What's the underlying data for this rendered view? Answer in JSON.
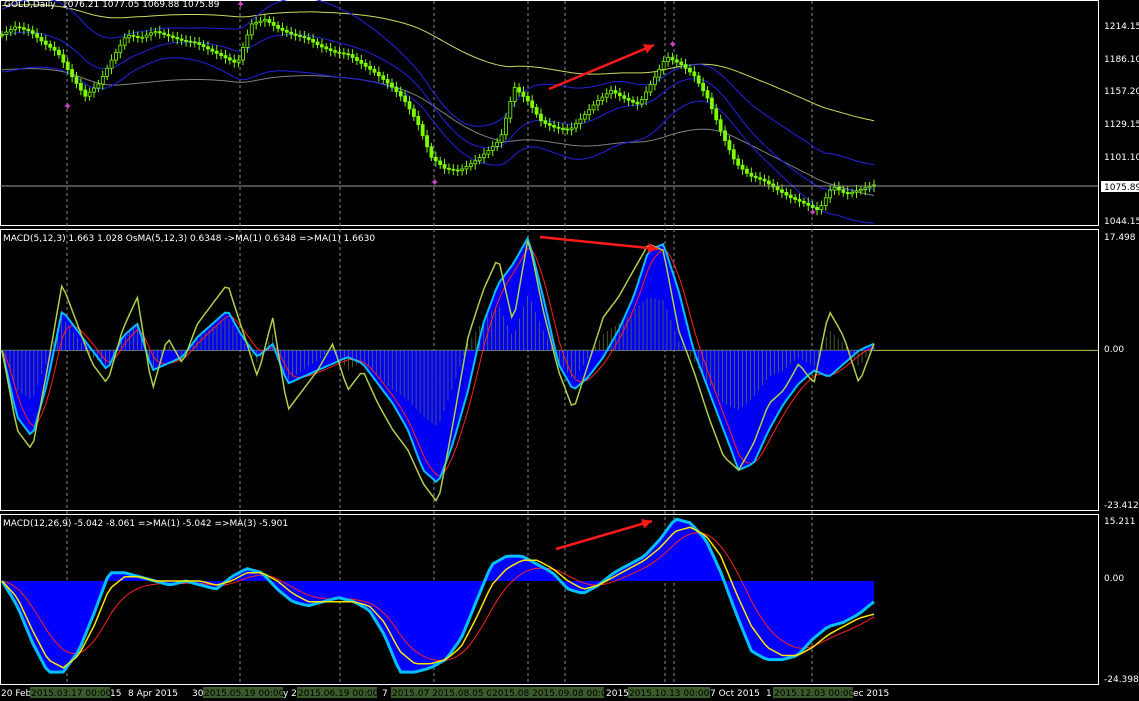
{
  "colors": {
    "background": "#000000",
    "price_candle": "#7CFC00",
    "bollinger": "#1E22E6",
    "ma_yellow": "#C8DC60",
    "ma_gray": "#808080",
    "macd_hist": "#0000FF",
    "macd_main": "#00BFFF",
    "signal_red": "#FF2020",
    "osma_line": "#ADD04A",
    "yellow_line": "#FFE600",
    "arrow": "#FF1A1A",
    "pane_border": "#FFFFFF",
    "date_box": "#3A5A2A"
  },
  "header": {
    "symbol": "GOLD,Daily",
    "ohlc": "1076.21 1077.05 1069.88 1075.89"
  },
  "pane1": {
    "price_axis": [
      "1214.15",
      "1186.10",
      "1157.20",
      "1129.15",
      "1101.10",
      "1075.89",
      "1044.15"
    ],
    "current_price": "1075.89"
  },
  "pane2": {
    "label": "MACD(5,12,3) 1.663 1.028  OsMA(5,12,3) 0.6348  ->MA(1) 0.6348  =>MA(1) 1.6630",
    "axis_top": "17.498",
    "axis_zero": "0.00",
    "axis_bottom": "-23.412"
  },
  "pane3": {
    "label": "MACD(12,26,9) -5.042 -8.061  =>MA(1) -5.042  =>MA(3) -5.901",
    "axis_top": "15.211",
    "axis_zero": "0.00",
    "axis_bottom": "-24.398"
  },
  "time_axis": {
    "labels": [
      "20 Feb",
      "15",
      "8 Apr 2015",
      "30",
      "y 20",
      "7",
      "2015",
      "2015",
      "7 Oct 2015",
      "1",
      "ec 2015"
    ],
    "date_boxes": [
      "2015.03.17 00:00",
      "2015.05.19 00:00",
      "2015.06.19 00:00",
      "2015.07 2015.08.05 00:",
      "2015.08 2015.09.08 00:00",
      "2015.10.13 00:00",
      "2015.12.03 00:00"
    ]
  },
  "chart_data": [
    {
      "type": "line",
      "title": "GOLD,Daily",
      "series": [
        {
          "name": "GOLD",
          "values": [
            1205,
            1212,
            1208,
            1198,
            1190,
            1170,
            1152,
            1163,
            1185,
            1205,
            1202,
            1208,
            1204,
            1200,
            1198,
            1192,
            1186,
            1180,
            1214,
            1218,
            1210,
            1205,
            1202,
            1195,
            1190,
            1188,
            1180,
            1172,
            1162,
            1150,
            1130,
            1100,
            1090,
            1088,
            1095,
            1104,
            1115,
            1160,
            1148,
            1130,
            1125,
            1123,
            1135,
            1148,
            1157,
            1150,
            1145,
            1165,
            1186,
            1180,
            1170,
            1150,
            1120,
            1095,
            1084,
            1080,
            1072,
            1065,
            1060,
            1054,
            1075,
            1068,
            1072,
            1076
          ]
        }
      ],
      "ylim": [
        1044.15,
        1214.15
      ]
    },
    {
      "type": "line",
      "title": "MACD(5,12,3) 1.663 1.028  OsMA(5,12,3) 0.6348  ->MA(1) 0.6348  =>MA(1) 1.6630",
      "series": [
        {
          "name": "",
          "values": [
            0,
            -10,
            -13,
            -5,
            6,
            3,
            0,
            -3,
            2,
            4,
            -3,
            -2,
            -1,
            2,
            4,
            6,
            2,
            -1,
            1,
            -5,
            -4,
            -3,
            -2,
            -1,
            -2,
            -5,
            -8,
            -12,
            -18,
            -20,
            -14,
            -6,
            4,
            10,
            13,
            17,
            8,
            -2,
            -6,
            -4,
            -1,
            3,
            8,
            15,
            16,
            9,
            0,
            -6,
            -12,
            -18,
            -17,
            -12,
            -8,
            -5,
            -3,
            -4,
            -2,
            0,
            1
          ]
        },
        {
          "name": "",
          "values": [
            0,
            -12,
            -15,
            -3,
            10,
            4,
            -2,
            -5,
            3,
            8,
            -6,
            2,
            -2,
            4,
            7,
            10,
            3,
            -4,
            5,
            -9,
            -6,
            -3,
            1,
            -6,
            -3,
            -8,
            -12,
            -15,
            -20,
            -23,
            -11,
            2,
            9,
            14,
            4,
            17,
            6,
            -3,
            -9,
            -2,
            5,
            8,
            12,
            16,
            15,
            3,
            -3,
            -10,
            -16,
            -18,
            -14,
            -8,
            -6,
            -2,
            -5,
            6,
            2,
            -5,
            1
          ]
        }
      ],
      "ylim": [
        -23.412,
        17.498
      ]
    },
    {
      "type": "line",
      "title": "MACD(12,26,9) -5.042 -8.061  =>MA(1) -5.042  =>MA(3) -5.901",
      "series": [
        {
          "name": "",
          "values": [
            0,
            -6,
            -15,
            -22,
            -22,
            -17,
            -8,
            2,
            2,
            1,
            0,
            -1,
            0,
            -1,
            -2,
            1,
            3,
            2,
            -2,
            -5,
            -6,
            -5,
            -4,
            -5,
            -7,
            -13,
            -22,
            -22,
            -21,
            -19,
            -14,
            -5,
            4,
            6,
            6,
            4,
            2,
            -2,
            -3,
            -1,
            2,
            4,
            6,
            10,
            15,
            14,
            10,
            2,
            -8,
            -17,
            -19,
            -19,
            -18,
            -14,
            -11,
            -10,
            -8,
            -5
          ]
        },
        {
          "name": "",
          "values": [
            0,
            -4,
            -12,
            -19,
            -21,
            -18,
            -11,
            -2,
            1,
            1,
            0,
            0,
            0,
            0,
            -1,
            0,
            2,
            2,
            0,
            -3,
            -5,
            -5,
            -5,
            -5,
            -6,
            -10,
            -17,
            -20,
            -20,
            -19,
            -16,
            -9,
            -1,
            3,
            5,
            5,
            3,
            0,
            -2,
            -1,
            1,
            3,
            5,
            8,
            12,
            13,
            11,
            6,
            -3,
            -11,
            -16,
            -18,
            -18,
            -16,
            -13,
            -11,
            -9,
            -8
          ]
        }
      ],
      "ylim": [
        -24.398,
        15.211
      ]
    }
  ]
}
